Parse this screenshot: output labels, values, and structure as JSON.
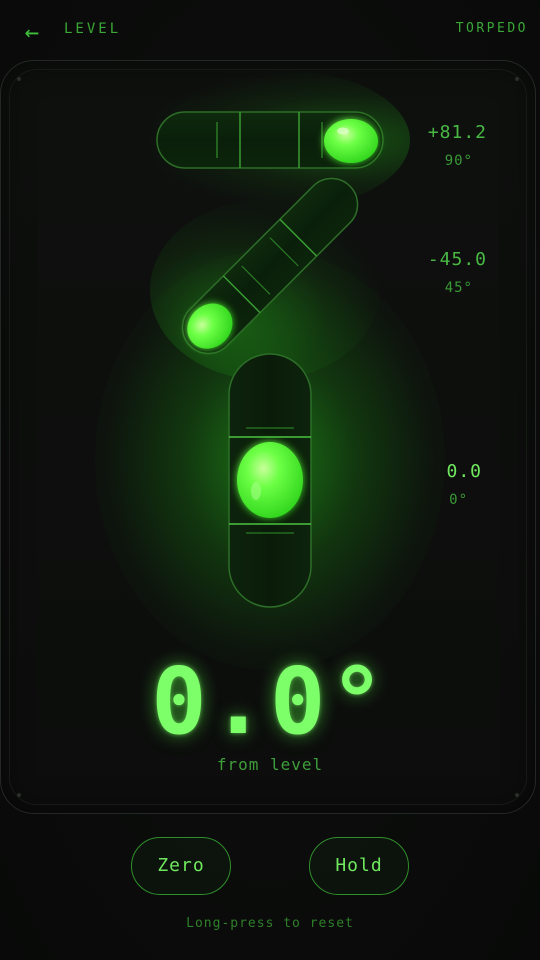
{
  "header": {
    "back_icon": "←",
    "title": "LEVEL",
    "mode": "TORPEDO"
  },
  "readouts": {
    "horizontal": {
      "value": "+81.2",
      "angle": "90°"
    },
    "diagonal": {
      "value": "-45.0",
      "angle": "45°"
    },
    "vertical": {
      "value": "0.0",
      "angle": "0°"
    }
  },
  "main": {
    "reading": "0.0°",
    "subtitle": "from level"
  },
  "buttons": {
    "zero": "Zero",
    "hold": "Hold"
  },
  "hint": "Long-press to reset",
  "colors": {
    "accent": "#7dff6a",
    "accent_dim": "#3aa836",
    "background": "#0a0b0a"
  }
}
